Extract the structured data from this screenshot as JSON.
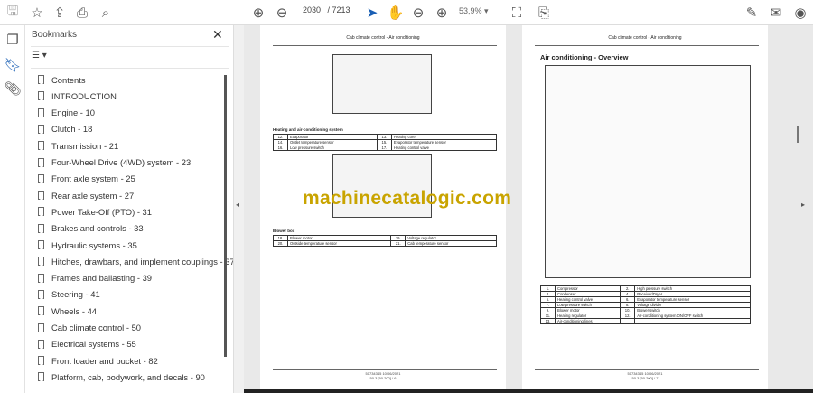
{
  "toolbar": {
    "current_page": "2030",
    "total_pages": "/ 7213",
    "zoom": "53,9%"
  },
  "panel": {
    "title": "Bookmarks",
    "close": "✕",
    "options": "☰ ▾"
  },
  "bookmarks": [
    "Contents",
    "INTRODUCTION",
    "Engine - 10",
    "Clutch - 18",
    "Transmission - 21",
    "Four-Wheel Drive (4WD) system - 23",
    "Front axle system - 25",
    "Rear axle system - 27",
    "Power Take-Off (PTO) - 31",
    "Brakes and controls - 33",
    "Hydraulic systems - 35",
    "Hitches, drawbars, and implement couplings - 37",
    "Frames and ballasting - 39",
    "Steering - 41",
    "Wheels - 44",
    "Cab climate control - 50",
    "Electrical systems - 55",
    "Front loader and bucket - 82",
    "Platform, cab, bodywork, and decals - 90"
  ],
  "left_page": {
    "header": "Cab climate control - Air conditioning",
    "section1": "Heating and air-conditioning system",
    "table1": [
      [
        "12.",
        "Evaporator",
        "13.",
        "Heating core"
      ],
      [
        "14.",
        "Outlet temperature sensor",
        "15.",
        "Evaporator temperature sensor"
      ],
      [
        "16.",
        "Low pressure switch",
        "17.",
        "Heating control valve"
      ]
    ],
    "section2": "Blower box",
    "table2": [
      [
        "18.",
        "Blower motor",
        "19.",
        "Voltage regulator"
      ],
      [
        "20.",
        "Outside temperature sensor",
        "21.",
        "Cab temperature sensor"
      ]
    ],
    "footer1": "51734345 10/06/2021",
    "footer2": "50.3 [50.200] / 6"
  },
  "right_page": {
    "header": "Cab climate control - Air conditioning",
    "title": "Air conditioning - Overview",
    "table": [
      [
        "1.",
        "Compressor",
        "2.",
        "High pressure switch"
      ],
      [
        "3.",
        "Condenser",
        "4.",
        "Receiver/Dryer"
      ],
      [
        "5.",
        "Heating control valve",
        "6.",
        "Evaporator temperature sensor"
      ],
      [
        "7.",
        "Low pressure switch",
        "8.",
        "Voltage divider"
      ],
      [
        "9.",
        "Blower motor",
        "10.",
        "Blower switch"
      ],
      [
        "11.",
        "Heating regulator",
        "12.",
        "Air-conditioning system ON/OFF switch"
      ],
      [
        "13.",
        "Air-conditioning lines",
        "",
        ""
      ]
    ],
    "footer1": "51734345 10/06/2021",
    "footer2": "50.3 [50.200] / 7"
  },
  "watermark": "machinecatalogic.com"
}
